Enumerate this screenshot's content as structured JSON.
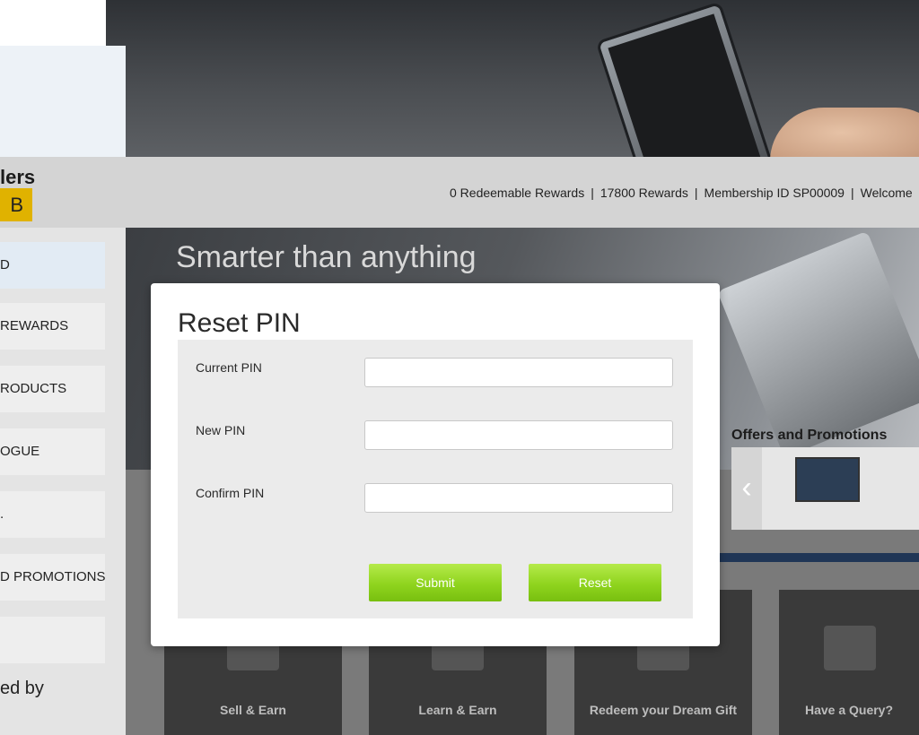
{
  "header": {
    "brand_text": "lers",
    "brand_badge": "B",
    "status": {
      "redeemable": "0  Redeemable Rewards",
      "rewards": "17800 Rewards",
      "membership": "Membership ID SP00009",
      "welcome": "Welcome",
      "separator": "|"
    }
  },
  "sidebar": {
    "items": [
      {
        "label": "D"
      },
      {
        "label": " REWARDS"
      },
      {
        "label": "RODUCTS"
      },
      {
        "label": "OGUE"
      },
      {
        "label": "."
      },
      {
        "label": "D PROMOTIONS"
      },
      {
        "label": ""
      }
    ],
    "powered_by": "ed by"
  },
  "banner": {
    "headline": "Smarter than anything"
  },
  "offers": {
    "title": "Offers and Promotions",
    "prev_icon": "‹"
  },
  "tiles": [
    {
      "label": "Sell & Earn",
      "icon": "laptop-coins-icon"
    },
    {
      "label": "Learn & Earn",
      "icon": "open-book-icon"
    },
    {
      "label": "Redeem your Dream Gift",
      "icon": "gift-box-icon"
    },
    {
      "label": "Have a Query?",
      "icon": "support-agent-icon"
    }
  ],
  "modal": {
    "title": "Reset PIN",
    "fields": [
      {
        "label": "Current PIN",
        "value": "",
        "placeholder": ""
      },
      {
        "label": "New PIN",
        "value": "",
        "placeholder": ""
      },
      {
        "label": "Confirm PIN",
        "value": "",
        "placeholder": ""
      }
    ],
    "submit_label": "Submit",
    "reset_label": "Reset"
  },
  "colors": {
    "button_green": "#8fd41e",
    "modal_bg": "#ffffff",
    "form_bg": "#ebebeb",
    "badge_yellow": "#e0b200"
  }
}
